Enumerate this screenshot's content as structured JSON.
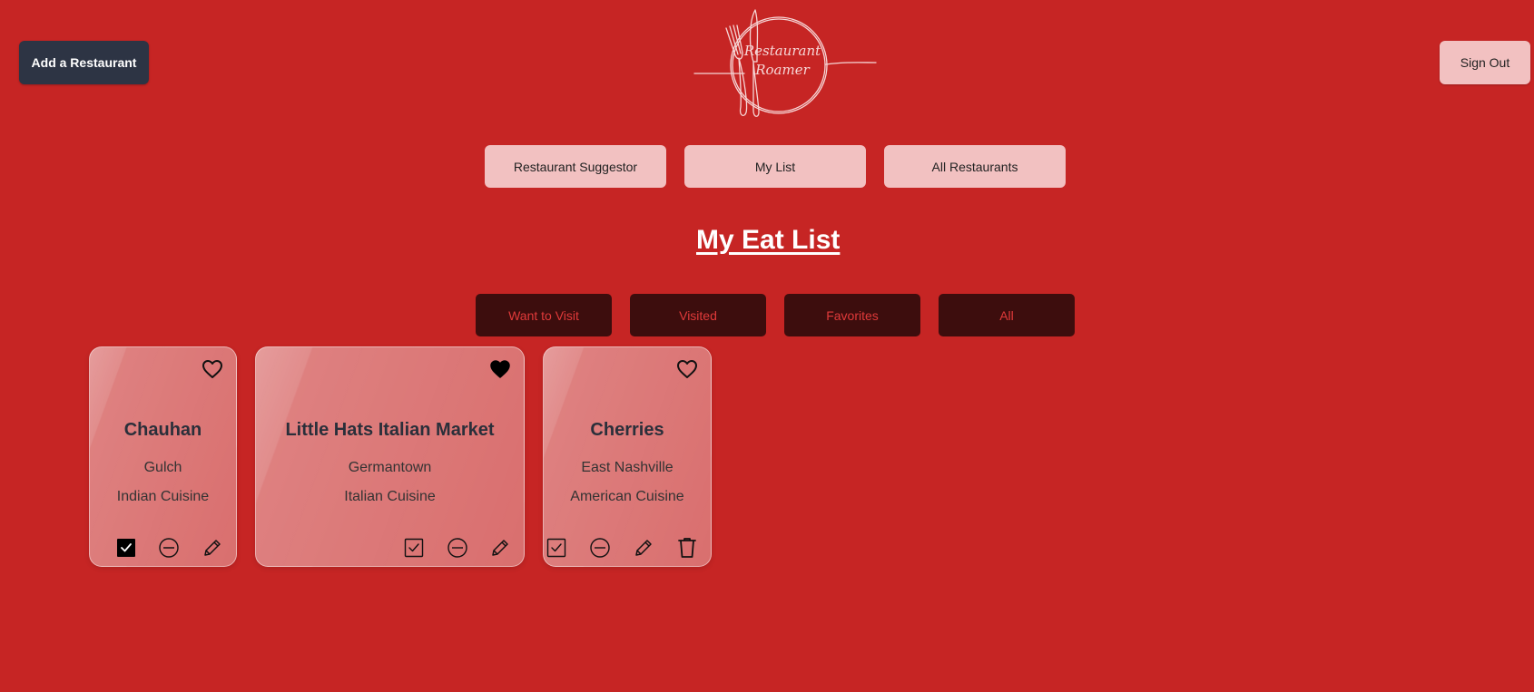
{
  "header": {
    "add_button": "Add a Restaurant",
    "signout_button": "Sign Out",
    "logo_text_line1": "Restaurant",
    "logo_text_line2": "Roamer"
  },
  "nav": [
    {
      "label": "Restaurant Suggestor"
    },
    {
      "label": "My List"
    },
    {
      "label": "All Restaurants"
    }
  ],
  "page_title": "My Eat List",
  "filters": [
    {
      "label": "Want to Visit"
    },
    {
      "label": "Visited"
    },
    {
      "label": "Favorites"
    },
    {
      "label": "All"
    }
  ],
  "cards": [
    {
      "name": "Chauhan",
      "area": "Gulch",
      "cuisine": "Indian Cuisine",
      "favorite": false,
      "visited": true,
      "icons": [
        "heart-outline-icon",
        "checkbox-checked-icon",
        "minus-circle-icon",
        "pencil-icon"
      ]
    },
    {
      "name": "Little Hats Italian Market",
      "area": "Germantown",
      "cuisine": "Italian Cuisine",
      "favorite": true,
      "visited": false,
      "icons": [
        "heart-filled-icon",
        "checkbox-icon",
        "minus-circle-icon",
        "pencil-icon"
      ]
    },
    {
      "name": "Cherries",
      "area": "East Nashville",
      "cuisine": "American Cuisine",
      "favorite": false,
      "visited": false,
      "icons": [
        "heart-outline-icon",
        "checkbox-icon",
        "minus-circle-icon",
        "pencil-icon",
        "trash-icon"
      ]
    }
  ],
  "colors": {
    "background": "#c62524",
    "dark_button": "#2d3444",
    "light_button": "#f2c1c1",
    "filter_button": "#3d0d0d",
    "filter_text": "#e03a3a"
  }
}
